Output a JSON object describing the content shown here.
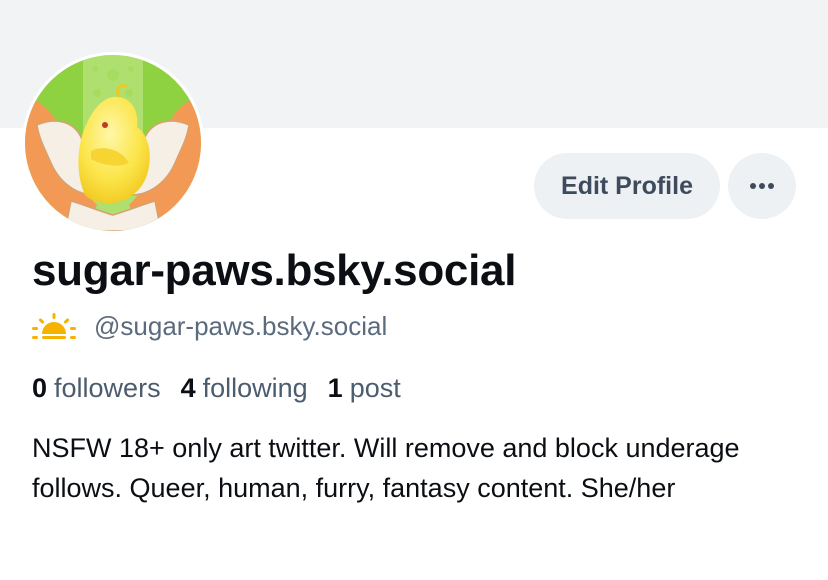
{
  "profile": {
    "display_name": "sugar-paws.bsky.social",
    "handle": "@sugar-paws.bsky.social",
    "status_icon": "sun-icon",
    "avatar_icon": "chick-in-hands-avatar",
    "bio": "NSFW 18+ only art twitter. Will remove and block underage follows. Queer, human, furry, fantasy content. She/her"
  },
  "actions": {
    "edit_label": "Edit Profile",
    "more_icon": "ellipsis-icon"
  },
  "stats": {
    "followers_count": "0",
    "followers_label": "followers",
    "following_count": "4",
    "following_label": "following",
    "posts_count": "1",
    "posts_label": "post"
  },
  "colors": {
    "banner": "#f1f3f5",
    "button_bg": "#eef1f4",
    "secondary_text": "#5b6b7d",
    "sun": "#f5b300"
  }
}
